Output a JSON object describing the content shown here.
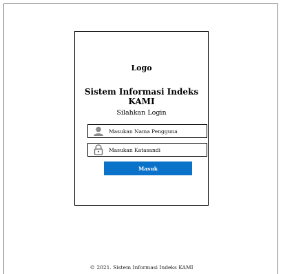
{
  "login": {
    "logo_text": "Logo",
    "app_title_line1": "Sistem Informasi Indeks",
    "app_title_line2": "KAMI",
    "subtitle": "Silahkan Login",
    "username_placeholder": "Masukan Nama Pengguna",
    "password_placeholder": "Masukan Katasandi",
    "submit_label": "Masuk",
    "icons": {
      "username": "user-icon",
      "password": "lock-icon"
    },
    "colors": {
      "button_bg": "#0a73c9",
      "button_text": "#ffffff"
    }
  },
  "footer": {
    "text": "© 2021. Sistem Informasi Indeks KAMI"
  }
}
